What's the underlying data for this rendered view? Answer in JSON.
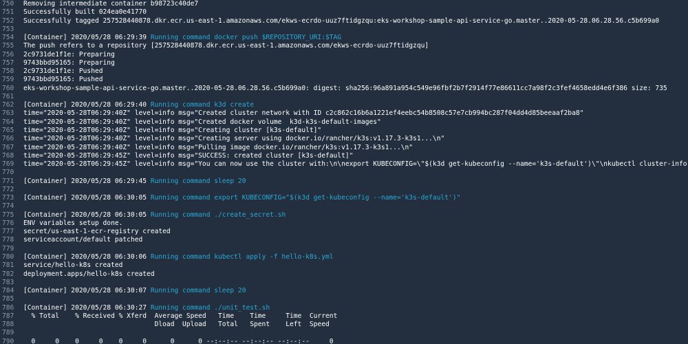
{
  "log": {
    "colors": {
      "background": "#232f3e",
      "line_number": "#8d99a8",
      "text": "#ffffff",
      "command": "#29a9d8"
    },
    "lines": [
      {
        "n": "750",
        "text": "Removing intermediate container b98723c40de7"
      },
      {
        "n": "751",
        "text": "Successfully built 024ea0e41770"
      },
      {
        "n": "752",
        "text": "Successfully tagged 257528440878.dkr.ecr.us-east-1.amazonaws.com/ekws-ecrdo-uuz7ftidgzqu:eks-workshop-sample-api-service-go.master..2020-05-28.06.28.56.c5b699a0"
      },
      {
        "n": "753",
        "text": ""
      },
      {
        "n": "754",
        "text": "[Container] 2020/05/28 06:29:39 ",
        "cmd": "Running command docker push $REPOSITORY_URI:$TAG"
      },
      {
        "n": "755",
        "text": "The push refers to a repository [257528440878.dkr.ecr.us-east-1.amazonaws.com/ekws-ecrdo-uuz7ftidgzqu]"
      },
      {
        "n": "756",
        "text": "2c9731de1f1e: Preparing"
      },
      {
        "n": "757",
        "text": "9743bbd95165: Preparing"
      },
      {
        "n": "758",
        "text": "2c9731de1f1e: Pushed"
      },
      {
        "n": "759",
        "text": "9743bbd95165: Pushed"
      },
      {
        "n": "760",
        "text": "eks-workshop-sample-api-service-go.master..2020-05-28.06.28.56.c5b699a0: digest: sha256:96a891a954c549e96fbf2b7f2914f77e86611cc7a98f2c3fef4658edd4e6f386 size: 735"
      },
      {
        "n": "761",
        "text": ""
      },
      {
        "n": "762",
        "text": "[Container] 2020/05/28 06:29:40 ",
        "cmd": "Running command k3d create"
      },
      {
        "n": "763",
        "text": "time=\"2020-05-28T06:29:40Z\" level=info msg=\"Created cluster network with ID c2c862c16b6a1221ef4eebc54b8508c57e7cb994bc287f04dd4d85beeaaf2ba8\""
      },
      {
        "n": "764",
        "text": "time=\"2020-05-28T06:29:40Z\" level=info msg=\"Created docker volume  k3d-k3s-default-images\""
      },
      {
        "n": "765",
        "text": "time=\"2020-05-28T06:29:40Z\" level=info msg=\"Creating cluster [k3s-default]\""
      },
      {
        "n": "766",
        "text": "time=\"2020-05-28T06:29:40Z\" level=info msg=\"Creating server using docker.io/rancher/k3s:v1.17.3-k3s1...\\n\""
      },
      {
        "n": "767",
        "text": "time=\"2020-05-28T06:29:40Z\" level=info msg=\"Pulling image docker.io/rancher/k3s:v1.17.3-k3s1...\\n\""
      },
      {
        "n": "768",
        "text": "time=\"2020-05-28T06:29:45Z\" level=info msg=\"SUCCESS: created cluster [k3s-default]\""
      },
      {
        "n": "769",
        "text": "time=\"2020-05-28T06:29:45Z\" level=info msg=\"You can now use the cluster with:\\n\\nexport KUBECONFIG=\\\"$(k3d get-kubeconfig --name='k3s-default')\\\"\\nkubectl cluster-info\""
      },
      {
        "n": "770",
        "text": ""
      },
      {
        "n": "771",
        "text": "[Container] 2020/05/28 06:29:45 ",
        "cmd": "Running command sleep 20"
      },
      {
        "n": "772",
        "text": ""
      },
      {
        "n": "773",
        "text": "[Container] 2020/05/28 06:30:05 ",
        "cmd": "Running command export KUBECONFIG=\"$(k3d get-kubeconfig --name='k3s-default')\""
      },
      {
        "n": "774",
        "text": ""
      },
      {
        "n": "775",
        "text": "[Container] 2020/05/28 06:30:05 ",
        "cmd": "Running command ./create_secret.sh"
      },
      {
        "n": "776",
        "text": "ENV variables setup done."
      },
      {
        "n": "777",
        "text": "secret/us-east-1-ecr-registry created"
      },
      {
        "n": "778",
        "text": "serviceaccount/default patched"
      },
      {
        "n": "779",
        "text": ""
      },
      {
        "n": "780",
        "text": "[Container] 2020/05/28 06:30:06 ",
        "cmd": "Running command kubectl apply -f hello-k8s.yml"
      },
      {
        "n": "781",
        "text": "service/hello-k8s created"
      },
      {
        "n": "782",
        "text": "deployment.apps/hello-k8s created"
      },
      {
        "n": "783",
        "text": ""
      },
      {
        "n": "784",
        "text": "[Container] 2020/05/28 06:30:07 ",
        "cmd": "Running command sleep 20"
      },
      {
        "n": "785",
        "text": ""
      },
      {
        "n": "786",
        "text": "[Container] 2020/05/28 06:30:27 ",
        "cmd": "Running command ./unit_test.sh"
      },
      {
        "n": "787",
        "text": "  % Total    % Received % Xferd  Average Speed   Time    Time     Time  Current"
      },
      {
        "n": "788",
        "text": "                                 Dload  Upload   Total   Spent    Left  Speed"
      },
      {
        "n": "789",
        "text": ""
      },
      {
        "n": "790",
        "text": "  0     0    0     0    0     0      0      0 --:--:-- --:--:-- --:--:--     0"
      }
    ]
  }
}
